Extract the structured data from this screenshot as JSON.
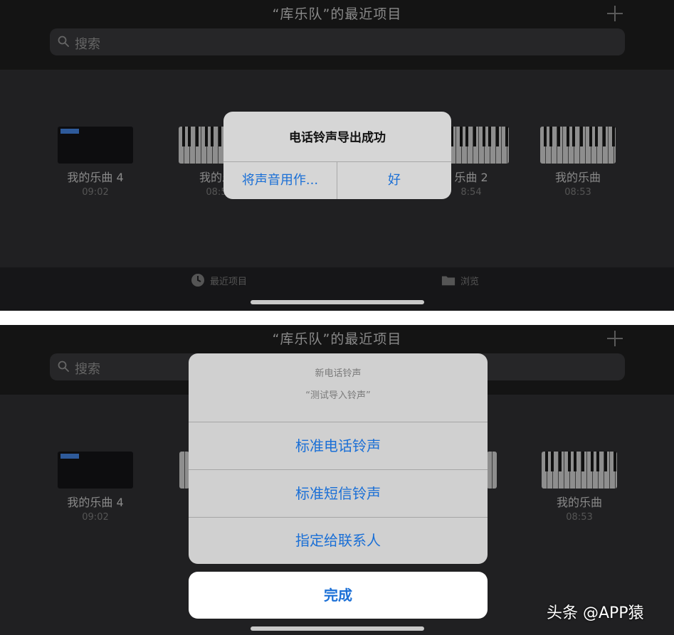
{
  "top_screen": {
    "nav_title": "“库乐队”的最近项目",
    "search_placeholder": "搜索",
    "songs": [
      {
        "name": "我的乐曲 4",
        "time": "09:02"
      },
      {
        "name": "我的乐",
        "time": "08:5"
      },
      {
        "name": "乐曲 2",
        "time": "8:54"
      },
      {
        "name": "我的乐曲",
        "time": "08:53"
      }
    ],
    "tabs": {
      "recent": "最近项目",
      "browse": "浏览"
    },
    "alert": {
      "title": "电话铃声导出成功",
      "use_sound_as": "将声音用作...",
      "ok": "好"
    }
  },
  "bottom_screen": {
    "nav_title": "“库乐队”的最近项目",
    "search_placeholder": "搜索",
    "songs": [
      {
        "name": "我的乐曲 4",
        "time": "09:02"
      },
      {
        "name": "我的乐曲",
        "time": "08:53"
      }
    ],
    "sheet": {
      "title": "新电话铃声",
      "message": "“测试导入铃声”",
      "items": [
        "标准电话铃声",
        "标准短信铃声",
        "指定给联系人"
      ],
      "done": "完成"
    }
  },
  "watermark": "头条 @APP猿",
  "colors": {
    "accent": "#1a6fd6",
    "background": "#1c1c1e"
  }
}
